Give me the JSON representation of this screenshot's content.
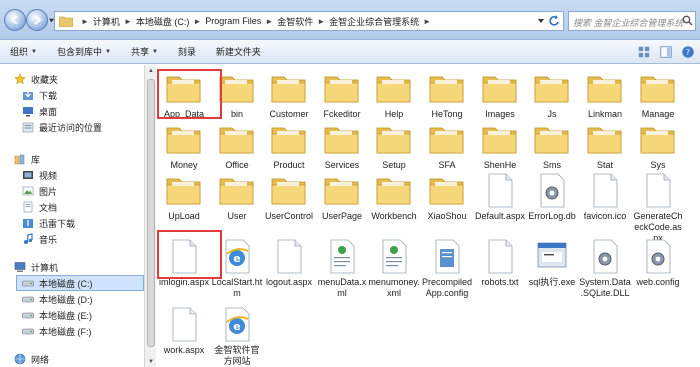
{
  "address": {
    "crumbs": [
      "计算机",
      "本地磁盘 (C:)",
      "Program Files",
      "金智软件",
      "金智企业综合管理系统"
    ],
    "search_placeholder": "搜索 金智企业综合管理系统"
  },
  "toolbar": {
    "organize": "组织",
    "include_in_library": "包含到库中",
    "share": "共享",
    "burn": "刻录",
    "new_folder": "新建文件夹"
  },
  "navpane": {
    "favorites": "收藏夹",
    "downloads": "下载",
    "desktop": "桌面",
    "recent": "最近访问的位置",
    "libraries": "库",
    "videos": "视频",
    "pictures": "图片",
    "documents": "文档",
    "xunlei": "迅雷下载",
    "music": "音乐",
    "computer": "计算机",
    "drive_c": "本地磁盘 (C:)",
    "drive_d": "本地磁盘 (D:)",
    "drive_e": "本地磁盘 (E:)",
    "drive_f": "本地磁盘 (F:)",
    "network": "网络"
  },
  "items": [
    {
      "label": "App_Data",
      "type": "folder"
    },
    {
      "label": "bin",
      "type": "folder"
    },
    {
      "label": "Customer",
      "type": "folder"
    },
    {
      "label": "Fckeditor",
      "type": "folder"
    },
    {
      "label": "Help",
      "type": "folder"
    },
    {
      "label": "HeTong",
      "type": "folder"
    },
    {
      "label": "Images",
      "type": "folder"
    },
    {
      "label": "Js",
      "type": "folder"
    },
    {
      "label": "Linkman",
      "type": "folder"
    },
    {
      "label": "Manage",
      "type": "folder"
    },
    {
      "label": "Money",
      "type": "folder"
    },
    {
      "label": "Office",
      "type": "folder"
    },
    {
      "label": "Product",
      "type": "folder"
    },
    {
      "label": "Services",
      "type": "folder"
    },
    {
      "label": "Setup",
      "type": "folder"
    },
    {
      "label": "SFA",
      "type": "folder"
    },
    {
      "label": "ShenHe",
      "type": "folder"
    },
    {
      "label": "Sms",
      "type": "folder"
    },
    {
      "label": "Stat",
      "type": "folder"
    },
    {
      "label": "Sys",
      "type": "folder"
    },
    {
      "label": "UpLoad",
      "type": "folder"
    },
    {
      "label": "User",
      "type": "folder"
    },
    {
      "label": "UserControl",
      "type": "folder"
    },
    {
      "label": "UserPage",
      "type": "folder"
    },
    {
      "label": "Workbench",
      "type": "folder"
    },
    {
      "label": "XiaoShou",
      "type": "folder"
    },
    {
      "label": "Default.aspx",
      "type": "file"
    },
    {
      "label": "ErrorLog.db",
      "type": "gear"
    },
    {
      "label": "favicon.ico",
      "type": "file"
    },
    {
      "label": "GenerateCheckCode.aspx",
      "type": "file"
    },
    {
      "label": "imlogin.aspx",
      "type": "file"
    },
    {
      "label": "LocalStart.htm",
      "type": "ie"
    },
    {
      "label": "logout.aspx",
      "type": "file"
    },
    {
      "label": "menuData.xml",
      "type": "xml"
    },
    {
      "label": "menumoney.xml",
      "type": "xml"
    },
    {
      "label": "PrecompiledApp.config",
      "type": "config"
    },
    {
      "label": "robots.txt",
      "type": "file"
    },
    {
      "label": "sql执行.exe",
      "type": "exe"
    },
    {
      "label": "System.Data.SQLite.DLL",
      "type": "gear"
    },
    {
      "label": "web.config",
      "type": "gear"
    },
    {
      "label": "work.aspx",
      "type": "file"
    },
    {
      "label": "金智软件官方网站",
      "type": "ie"
    }
  ]
}
